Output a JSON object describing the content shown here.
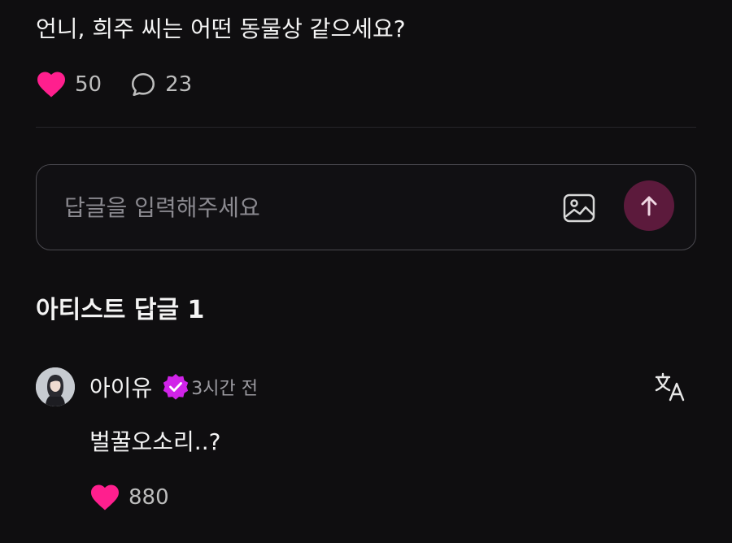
{
  "post": {
    "text": "언니, 희주 씨는 어떤 동물상 같으세요?",
    "likes": "50",
    "comments": "23",
    "like_icon": "heart-icon",
    "comment_icon": "speech-bubble-icon",
    "like_color": "#ff1f8e"
  },
  "reply_box": {
    "placeholder": "답글을 입력해주세요",
    "value": "",
    "image_icon": "image-icon",
    "send_icon": "arrow-up-icon",
    "send_bg": "#5c1a3c"
  },
  "artist_replies": {
    "title": "아티스트 답글 1",
    "items": [
      {
        "author": "아이유",
        "verified_icon": "verified-badge-icon",
        "verified_color": "#d023e8",
        "time": "3시간 전",
        "body": "벌꿀오소리..?",
        "likes": "880",
        "translate_icon": "translate-icon"
      }
    ]
  }
}
